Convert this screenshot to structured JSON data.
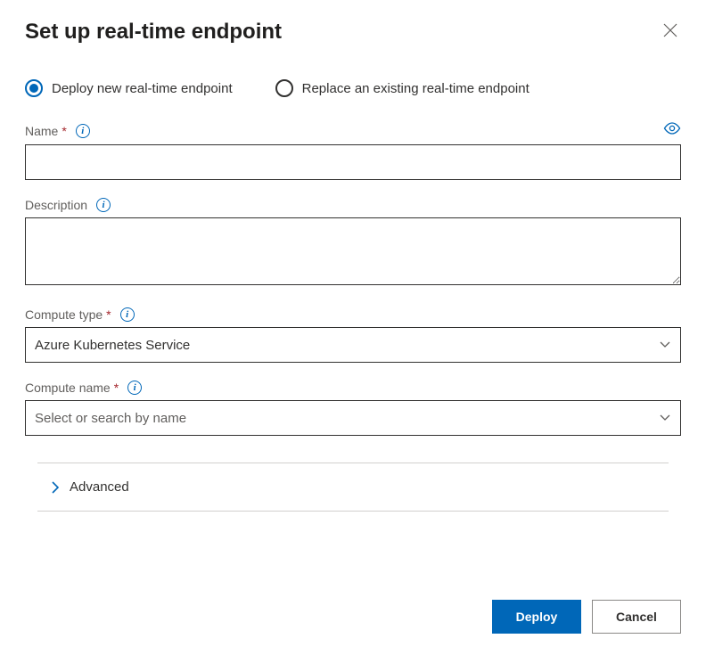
{
  "dialog": {
    "title": "Set up real-time endpoint"
  },
  "radios": {
    "deploy_new": "Deploy new real-time endpoint",
    "replace_existing": "Replace an existing real-time endpoint"
  },
  "fields": {
    "name": {
      "label": "Name",
      "value": ""
    },
    "description": {
      "label": "Description",
      "value": ""
    },
    "compute_type": {
      "label": "Compute type",
      "value": "Azure Kubernetes Service"
    },
    "compute_name": {
      "label": "Compute name",
      "placeholder": "Select or search by name"
    }
  },
  "advanced": {
    "label": "Advanced"
  },
  "buttons": {
    "deploy": "Deploy",
    "cancel": "Cancel"
  }
}
